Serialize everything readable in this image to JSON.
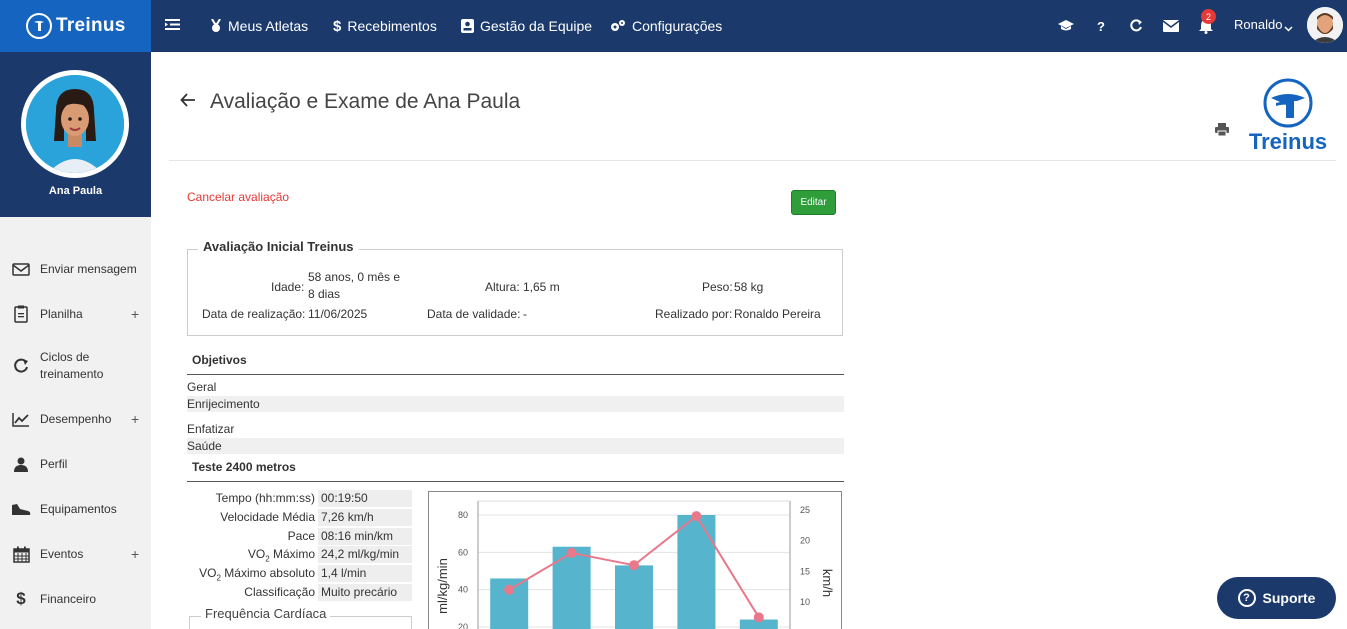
{
  "brand": {
    "name": "Treinus"
  },
  "nav": {
    "items": [
      {
        "label": "Meus Atletas",
        "icon": "medal-icon"
      },
      {
        "label": "Recebimentos",
        "icon": "dollar-icon"
      },
      {
        "label": "Gestão da Equipe",
        "icon": "id-card-icon"
      },
      {
        "label": "Configurações",
        "icon": "gears-icon"
      }
    ],
    "notifications_count": "2",
    "user_name": "Ronaldo"
  },
  "athlete": {
    "name": "Ana Paula"
  },
  "sidebar": {
    "items": [
      {
        "label": "Enviar mensagem",
        "icon": "envelope-icon",
        "expandable": false
      },
      {
        "label": "Planilha",
        "icon": "clipboard-icon",
        "expandable": true
      },
      {
        "label": "Ciclos de treinamento",
        "icon": "cycle-icon",
        "expandable": false
      },
      {
        "label": "Desempenho",
        "icon": "chart-line-icon",
        "expandable": true
      },
      {
        "label": "Perfil",
        "icon": "user-icon",
        "expandable": false
      },
      {
        "label": "Equipamentos",
        "icon": "shoe-icon",
        "expandable": false
      },
      {
        "label": "Eventos",
        "icon": "calendar-icon",
        "expandable": true
      },
      {
        "label": "Financeiro",
        "icon": "dollar-icon",
        "expandable": false
      }
    ],
    "plus_symbol": "+"
  },
  "page": {
    "title": "Avaliação e Exame de Ana Paula",
    "logo_text": "Treinus",
    "cancel_label": "Cancelar avaliação",
    "edit_label": "Editar"
  },
  "evaluation": {
    "legend": "Avaliação Inicial Treinus",
    "idade_label": "Idade:",
    "idade_value_line1": "58 anos, 0 mês e",
    "idade_value_line2": "8 dias",
    "altura_label": "Altura:",
    "altura_value": "1,65 m",
    "peso_label": "Peso:",
    "peso_value": "58 kg",
    "data_realizacao_label": "Data de realização:",
    "data_realizacao_value": "11/06/2025",
    "data_validade_label": "Data de validade:",
    "data_validade_value": "-",
    "realizado_label": "Realizado por:",
    "realizado_value": "Ronaldo Pereira"
  },
  "objetivos": {
    "title": "Objetivos",
    "geral_label": "Geral",
    "geral_value": "Enrijecimento",
    "enfatizar_label": "Enfatizar",
    "enfatizar_value": "Saúde"
  },
  "teste": {
    "title": "Teste 2400 metros",
    "rows": [
      {
        "label": "Tempo (hh:mm:ss)",
        "value": "00:19:50"
      },
      {
        "label": "Velocidade Média",
        "value": "7,26 km/h"
      },
      {
        "label": "Pace",
        "value": "08:16 min/km"
      },
      {
        "label_prefix": "VO",
        "label_sub": "2",
        "label_suffix": " Máximo",
        "value": "24,2 ml/kg/min"
      },
      {
        "label_prefix": "VO",
        "label_sub": "2",
        "label_suffix": " Máximo absoluto",
        "value": "1,4 l/min"
      },
      {
        "label": "Classificação",
        "value": "Muito precário"
      }
    ],
    "fc_legend": "Frequência Cardíaca"
  },
  "chart_data": {
    "type": "bar",
    "ylabel": "ml/kg/min",
    "y2label": "km/h",
    "ylim_visible": [
      20,
      80
    ],
    "y_ticks": [
      20,
      40,
      60,
      80
    ],
    "y2_ticks": [
      10,
      15,
      20,
      25
    ],
    "series": [
      {
        "axis": "left",
        "type": "bar",
        "color": "#56b4cc",
        "values": [
          46,
          63,
          53,
          80,
          24
        ]
      },
      {
        "axis": "right",
        "type": "line",
        "color": "#e8788a",
        "values": [
          12,
          18,
          16,
          24,
          7.5
        ]
      }
    ]
  },
  "support": {
    "label": "Suporte"
  }
}
